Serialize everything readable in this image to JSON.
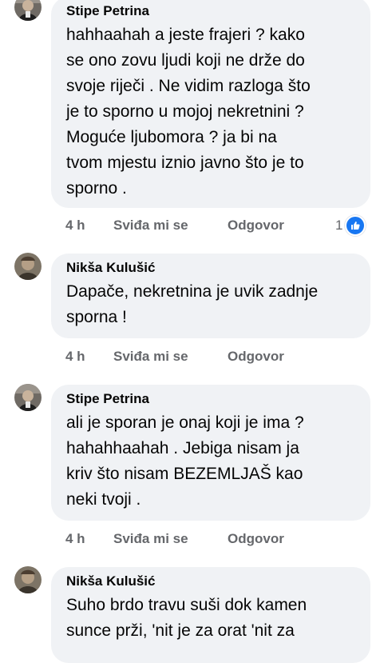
{
  "comments": [
    {
      "author": "Stipe Petrina",
      "text": "hahhaahah a jeste frajeri ? kako\nse ono zovu ljudi koji ne drže do\nsvoje riječi . Ne vidim razloga što\nje to sporno u mojoj nekretnini ?\nMoguće ljubomora ? ja bi na\ntvom mjestu iznio javno što je to\nsporno .",
      "time": "4 h",
      "like_label": "Sviđa mi se",
      "reply_label": "Odgovor",
      "reaction_count": "1"
    },
    {
      "author": "Nikša Kulušić",
      "text": "Dapače, nekretnina je uvik zadnje\nsporna !",
      "time": "4 h",
      "like_label": "Sviđa mi se",
      "reply_label": "Odgovor"
    },
    {
      "author": "Stipe Petrina",
      "text": "ali je sporan je onaj koji je ima ?\nhahahhaahah  . Jebiga nisam ja\nkriv što nisam BEZEMLJAŠ kao\nneki tvoji .",
      "time": "4 h",
      "like_label": "Sviđa mi se",
      "reply_label": "Odgovor"
    },
    {
      "author": "Nikša Kulušić",
      "text": "Suho brdo travu suši dok kamen\nsunce prži, 'nit je za orat 'nit za"
    }
  ],
  "colors": {
    "bubble": "#f0f2f5",
    "meta_text": "#65676b",
    "like_blue": "#1877f2"
  }
}
